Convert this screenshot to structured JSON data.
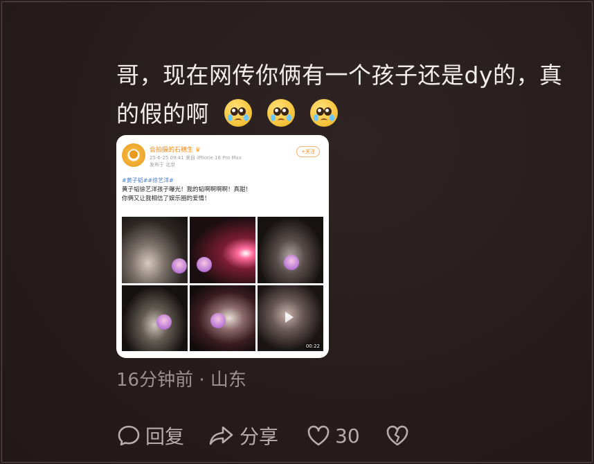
{
  "comment": {
    "line1": "哥，现在网传你俩有一个孩子还是dy的，真",
    "line2": "的假的啊",
    "emojis": [
      "crying-face",
      "crying-face",
      "crying-face"
    ]
  },
  "embedded_post": {
    "username": "会拍摄的石穗生",
    "crown": "♛",
    "meta_line1": "25-6-25 09:41  来自 iPhone 16 Pro Max",
    "meta_line2": "发布于 北京",
    "follow_label": "+关注",
    "tags": "#黄子韬##徐艺洋#",
    "body_line1": "黄子韬徐艺洋孩子曝光！我的韬啊啊啊啊！真甜！",
    "body_line2": "你俩又让我相信了娱乐圈的爱情！",
    "video_duration": "00:22"
  },
  "time_location": "16分钟前 · 山东",
  "actions": {
    "reply_label": "回复",
    "share_label": "分享",
    "like_count": "30"
  },
  "colors": {
    "background": "#2a1f1f",
    "text": "#f2ecec",
    "muted": "#9c9292",
    "accent_orange": "#f08a1a"
  }
}
